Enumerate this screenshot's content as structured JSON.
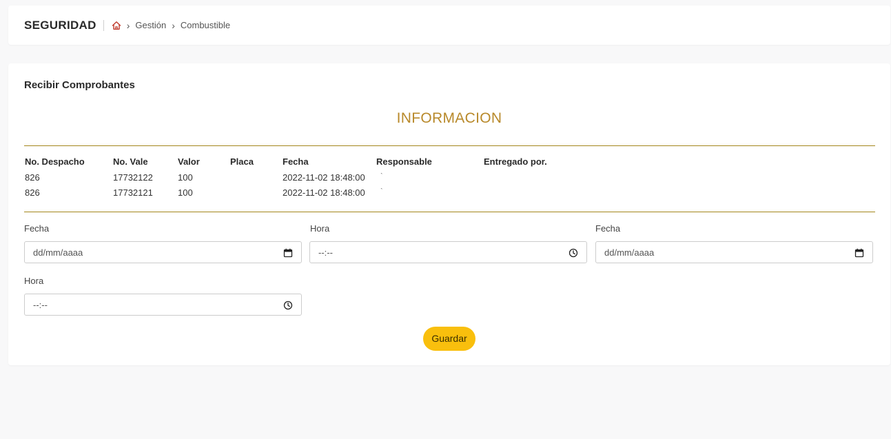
{
  "header": {
    "brand": "SEGURIDAD",
    "breadcrumb": [
      "Gestión",
      "Combustible"
    ]
  },
  "card": {
    "title": "Recibir Comprobantes",
    "section_title": "INFORMACION"
  },
  "table": {
    "headers": [
      "No. Despacho",
      "No. Vale",
      "Valor",
      "Placa",
      "Fecha",
      "Responsable",
      "Entregado por."
    ],
    "rows": [
      [
        "826",
        "17732122",
        "100",
        "",
        "2022-11-02 18:48:00",
        "",
        ""
      ],
      [
        "826",
        "17732121",
        "100",
        "",
        "2022-11-02 18:48:00",
        "",
        ""
      ]
    ]
  },
  "form": {
    "fecha1_label": "Fecha",
    "fecha1_placeholder": "dd/mm/aaaa",
    "hora1_label": "Hora",
    "hora1_placeholder": "--:--",
    "fecha2_label": "Fecha",
    "fecha2_placeholder": "dd/mm/aaaa",
    "hora2_label": "Hora",
    "hora2_placeholder": "--:--",
    "save_label": "Guardar"
  },
  "colors": {
    "accent": "#b8892a",
    "divider": "#a3861b",
    "button": "#f9bf0d",
    "home_icon": "#c0392b"
  },
  "icons": {
    "home": "home-icon",
    "calendar": "calendar-icon",
    "clock": "clock-icon"
  }
}
